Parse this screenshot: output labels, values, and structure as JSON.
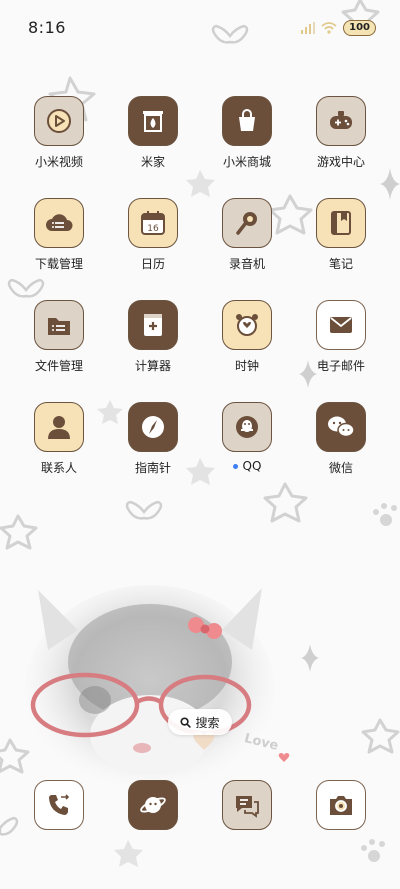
{
  "status_bar": {
    "time": "8:16",
    "battery": "100"
  },
  "apps": [
    {
      "label": "小米视频",
      "icon": "video-play-icon"
    },
    {
      "label": "米家",
      "icon": "mijia-home-icon"
    },
    {
      "label": "小米商城",
      "icon": "shopping-bag-icon"
    },
    {
      "label": "游戏中心",
      "icon": "gamepad-icon"
    },
    {
      "label": "下载管理",
      "icon": "cloud-download-icon"
    },
    {
      "label": "日历",
      "icon": "calendar-icon",
      "date": "16"
    },
    {
      "label": "录音机",
      "icon": "microphone-icon"
    },
    {
      "label": "笔记",
      "icon": "notebook-icon"
    },
    {
      "label": "文件管理",
      "icon": "folder-icon"
    },
    {
      "label": "计算器",
      "icon": "calculator-icon"
    },
    {
      "label": "时钟",
      "icon": "alarm-clock-icon"
    },
    {
      "label": "电子邮件",
      "icon": "envelope-icon"
    },
    {
      "label": "联系人",
      "icon": "contact-person-icon"
    },
    {
      "label": "指南针",
      "icon": "compass-icon"
    },
    {
      "label": "QQ",
      "icon": "penguin-icon"
    },
    {
      "label": "微信",
      "icon": "wechat-icon"
    }
  ],
  "search": {
    "label": "搜索"
  },
  "wallpaper": {
    "text": "Love"
  },
  "dock": [
    {
      "icon": "phone-icon"
    },
    {
      "icon": "planet-browser-icon"
    },
    {
      "icon": "message-bubble-icon"
    },
    {
      "icon": "camera-icon"
    }
  ],
  "colors": {
    "dark_tile": "#6b4f3b",
    "light_tile": "#f6e2b6",
    "grey_tile": "#ddd3c6",
    "notify_dot": "#3d7ff5"
  }
}
